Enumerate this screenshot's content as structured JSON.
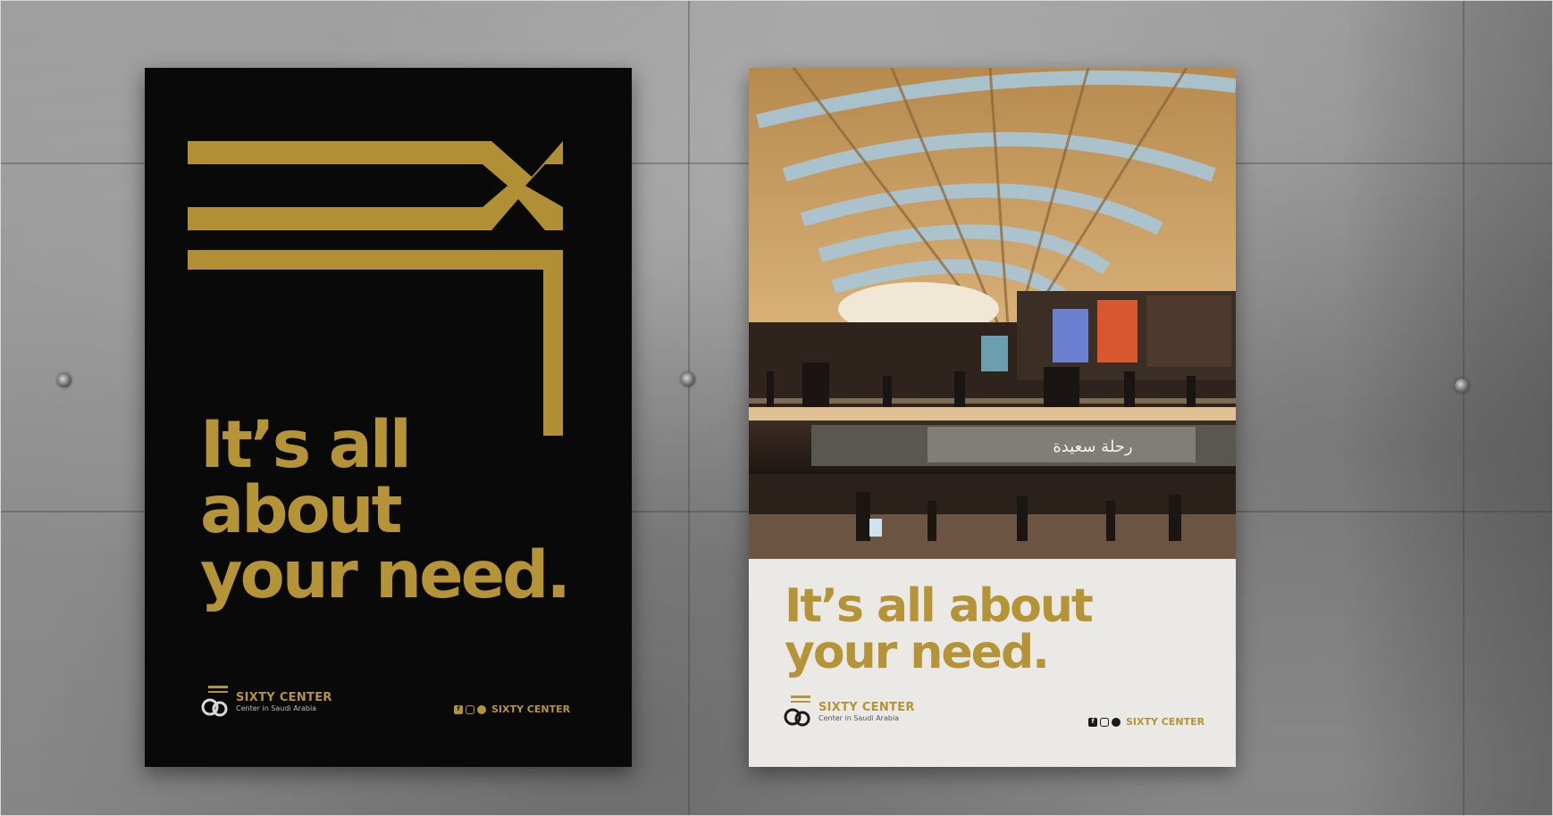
{
  "scene": "two posters mounted on a concrete wall",
  "colors": {
    "gold": "#b59437",
    "poster_black": "#090909",
    "poster_white": "#eae9e5",
    "concrete": "#8f8f8f"
  },
  "poster_black": {
    "headline": [
      "It’s all",
      "about",
      "your need."
    ],
    "brand": {
      "name": "SIXTY CENTER",
      "tagline": "Center in Saudi Arabia"
    },
    "social": {
      "icons": [
        "facebook-icon",
        "instagram-icon",
        "twitter-icon"
      ],
      "handle": "SIXTY CENTER"
    }
  },
  "poster_white": {
    "headline": [
      "It’s all about",
      "your need."
    ],
    "photo_caption": "رحلة سعيدة",
    "brand": {
      "name": "SIXTY CENTER",
      "tagline": "Center in Saudi Arabia"
    },
    "social": {
      "icons": [
        "facebook-icon",
        "instagram-icon",
        "twitter-icon"
      ],
      "handle": "SIXTY CENTER"
    }
  }
}
